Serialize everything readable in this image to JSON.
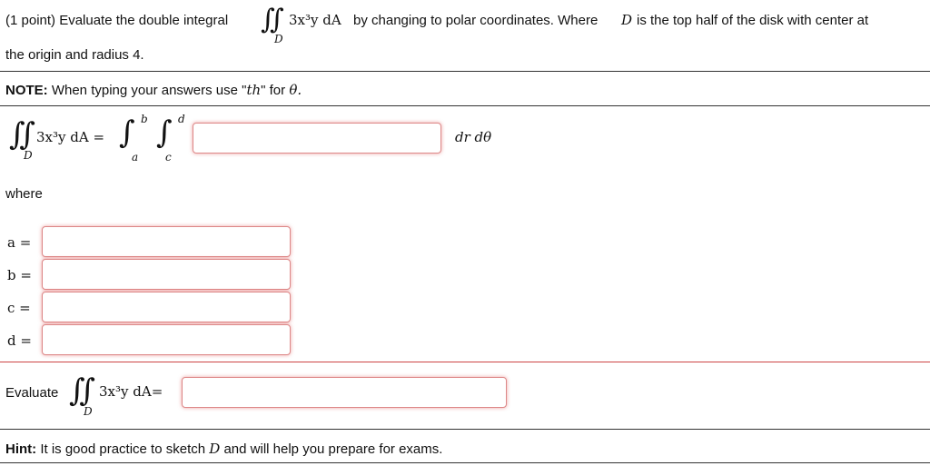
{
  "problem": {
    "prefix": "(1 point) Evaluate the double integral",
    "integrand": "3x³y dA",
    "middle": "by changing to polar coordinates. Where",
    "region_var": "D",
    "suffix": "is the top half of the disk with center at",
    "line2": "the origin and radius 4."
  },
  "note": {
    "label": "NOTE:",
    "text": "When typing your answers use \"",
    "code": "th",
    "text2": "\" for",
    "theta": "θ."
  },
  "setup": {
    "integrand": "3x³y dA =",
    "lower_d": "D",
    "outer_upper": "b",
    "outer_lower": "a",
    "inner_upper": "d",
    "inner_lower": "c",
    "differential": "dr dθ",
    "integrand_value": ""
  },
  "where_label": "where",
  "limits": {
    "a_label": "a =",
    "b_label": "b =",
    "c_label": "c =",
    "d_label": "d =",
    "a_value": "",
    "b_value": "",
    "c_value": "",
    "d_value": ""
  },
  "evaluate": {
    "label": "Evaluate",
    "integrand": "3x³y dA=",
    "lower_d": "D",
    "value": ""
  },
  "hint": {
    "label": "Hint:",
    "text": "It is good practice to sketch",
    "var": "D",
    "text2": "and will help you prepare for exams."
  }
}
